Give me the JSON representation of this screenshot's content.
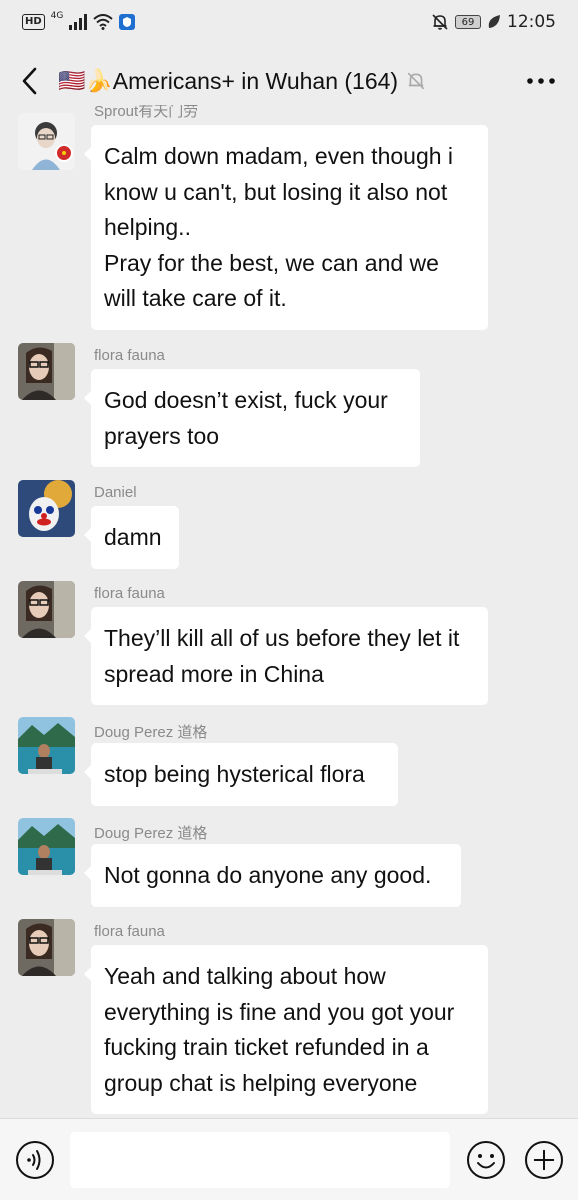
{
  "status_bar": {
    "network_badge": "HD",
    "network_type": "4G",
    "battery": "69",
    "time": "12:05"
  },
  "header": {
    "title_prefix": "🇺🇸🍌",
    "title": "Americans+ in Wuhan (164)"
  },
  "messages": [
    {
      "sender": "Sprout有天门劳",
      "text": "Calm down madam, even though i know u can't, but losing it also not helping..\nPray for the best, we can and we will take care of it."
    },
    {
      "sender": "flora fauna",
      "text": "God doesn’t exist, fuck your prayers too"
    },
    {
      "sender": "Daniel",
      "text": "damn"
    },
    {
      "sender": "flora fauna",
      "text": "They’ll kill all of us before they let it spread more in China"
    },
    {
      "sender": "Doug Perez 道格",
      "text": "stop being hysterical flora"
    },
    {
      "sender": "Doug Perez 道格",
      "text": "Not gonna do anyone any good."
    },
    {
      "sender": "flora fauna",
      "text": "Yeah and talking about how everything is fine and you got your fucking train ticket refunded in a group chat is helping everyone"
    }
  ],
  "input": {
    "placeholder": ""
  },
  "icons": {
    "back": "chevron-left-icon",
    "mute": "bell-off-icon",
    "more": "more-dots-icon",
    "voice": "voice-icon",
    "emoji": "emoji-icon",
    "plus": "plus-icon"
  }
}
